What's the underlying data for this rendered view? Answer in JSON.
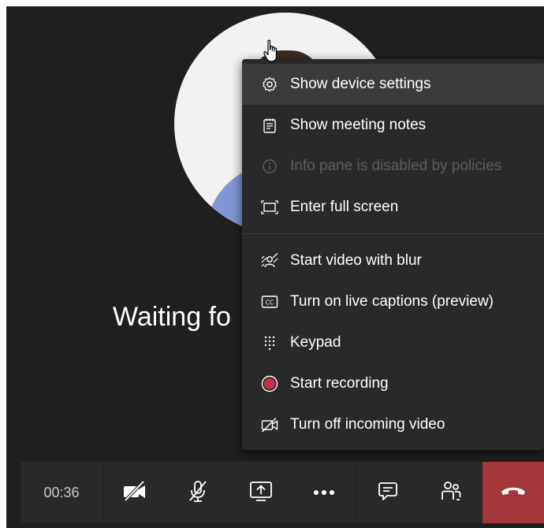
{
  "call": {
    "waiting_text": "Waiting fo",
    "timer": "00:36"
  },
  "menu": {
    "items": [
      {
        "label": "Show device settings",
        "icon": "gear-icon",
        "state": "hovered"
      },
      {
        "label": "Show meeting notes",
        "icon": "notes-icon",
        "state": "normal"
      },
      {
        "label": "Info pane is disabled by policies",
        "icon": "info-icon",
        "state": "disabled"
      },
      {
        "label": "Enter full screen",
        "icon": "fullscreen-icon",
        "state": "normal"
      },
      {
        "label": "Start video with blur",
        "icon": "blur-icon",
        "state": "normal"
      },
      {
        "label": "Turn on live captions (preview)",
        "icon": "captions-icon",
        "state": "normal"
      },
      {
        "label": "Keypad",
        "icon": "keypad-icon",
        "state": "normal"
      },
      {
        "label": "Start recording",
        "icon": "record-icon",
        "state": "normal"
      },
      {
        "label": "Turn off incoming video",
        "icon": "video-off-icon",
        "state": "normal"
      }
    ]
  },
  "toolbar": {
    "buttons": [
      "camera-off-icon",
      "mic-off-icon",
      "share-icon",
      "more-icon",
      "chat-icon",
      "participants-icon",
      "hang-up-icon"
    ]
  },
  "colors": {
    "stage_bg": "#1f1f1f",
    "menu_bg": "#292929",
    "hang_up": "#a4373a",
    "record_dot": "#c4314b"
  }
}
